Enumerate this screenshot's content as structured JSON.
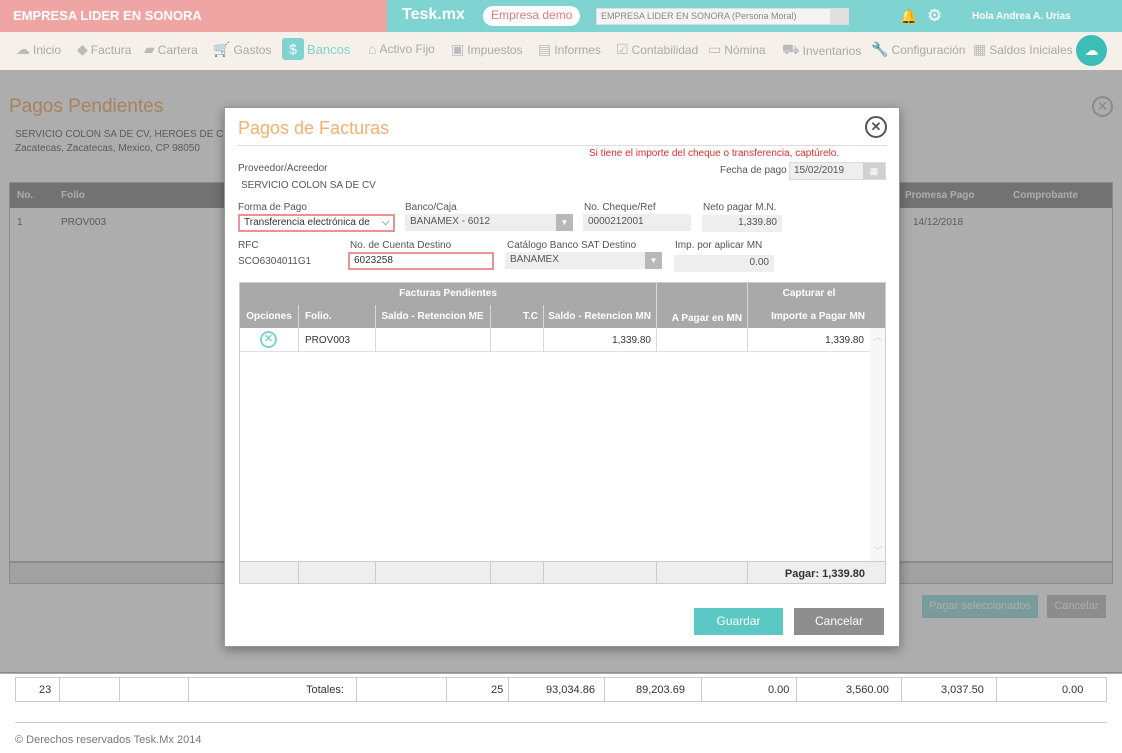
{
  "topbar": {
    "company_title": "EMPRESA LIDER EN SONORA",
    "logo": "Tesk.mx",
    "demo_label": "Empresa demo",
    "company_select": "EMPRESA LIDER EN SONORA (Persona Moral)",
    "bell_icon": "bell-icon",
    "gear_icon": "gear-icon",
    "greeting": "Hola Andrea A. Urias"
  },
  "nav": {
    "items": [
      {
        "label": "Inicio",
        "icon": "cloud-icon"
      },
      {
        "label": "Factura",
        "icon": "tag-icon"
      },
      {
        "label": "Cartera",
        "icon": "wallet-icon"
      },
      {
        "label": "Gastos",
        "icon": "cart-icon"
      },
      {
        "label": "Bancos",
        "icon": "bank-icon",
        "active": true
      },
      {
        "label": "Activo Fijo",
        "icon": "home-icon"
      },
      {
        "label": "Impuestos",
        "icon": "briefcase-icon"
      },
      {
        "label": "Informes",
        "icon": "document-icon"
      },
      {
        "label": "Contabilidad",
        "icon": "checklist-icon"
      },
      {
        "label": "Nómina",
        "icon": "card-icon"
      },
      {
        "label": "Inventarios",
        "icon": "dolly-icon"
      },
      {
        "label": "Configuración",
        "icon": "wrench-icon"
      },
      {
        "label": "Saldos Iniciales",
        "icon": "file-check-icon"
      }
    ]
  },
  "background": {
    "title": "Pagos Pendientes",
    "address_line1": "SERVICIO COLON SA DE CV, HEROES DE CHAP",
    "address_line2": "Zacatecas, Zacatecas, Mexico, CP 98050",
    "headers": {
      "no": "No.",
      "folio": "Folio",
      "promesa": "Promesa Pago",
      "comprobante": "Comprobante"
    },
    "row": {
      "no": "1",
      "folio": "PROV003",
      "promesa": "14/12/2018"
    },
    "pay_selected": "Pagar seleccionados",
    "cancel": "Cancelar",
    "totals": {
      "count": "23",
      "label": "Totales:",
      "qty": "25",
      "v1": "93,034.86",
      "v2": "89,203.69",
      "v3": "0.00",
      "v4": "3,560.00",
      "v5": "3,037.50",
      "v6": "0.00"
    },
    "footer": "© Derechos reservados Tesk.Mx 2014"
  },
  "modal": {
    "title": "Pagos de Facturas",
    "warning": "Si tiene el importe del cheque o transferencia, captúrelo.",
    "proveedor_label": "Proveedor/Acreedor",
    "proveedor_value": "SERVICIO COLON SA DE CV",
    "fecha_label": "Fecha de pago",
    "fecha_value": "15/02/2019",
    "forma_label": "Forma de Pago",
    "forma_value": "Transferencia electrónica de",
    "banco_label": "Banco/Caja",
    "banco_value": "BANAMEX - 6012",
    "cheque_label": "No. Cheque/Ref",
    "cheque_value": "0000212001",
    "neto_label": "Neto pagar M.N.",
    "neto_value": "1,339.80",
    "rfc_label": "RFC",
    "rfc_value": "SCO6304011G1",
    "cuenta_label": "No. de Cuenta Destino",
    "cuenta_value": "6023258",
    "sat_label": "Catálogo Banco SAT Destino",
    "sat_value": "BANAMEX",
    "imp_label": "Imp. por aplicar MN",
    "imp_value": "0.00",
    "grid": {
      "group_pending": "Facturas Pendientes",
      "group_capture": "Capturar el",
      "headers": [
        "Opciones",
        "Folio.",
        "Saldo - Retencion ME",
        "T.C",
        "Saldo - Retencion MN",
        "A Pagar en MN",
        "Importe a Pagar MN"
      ],
      "row": {
        "folio": "PROV003",
        "saldo_mn": "1,339.80",
        "importe": "1,339.80"
      },
      "total": "Pagar: 1,339.80"
    },
    "save": "Guardar",
    "cancel": "Cancelar"
  }
}
